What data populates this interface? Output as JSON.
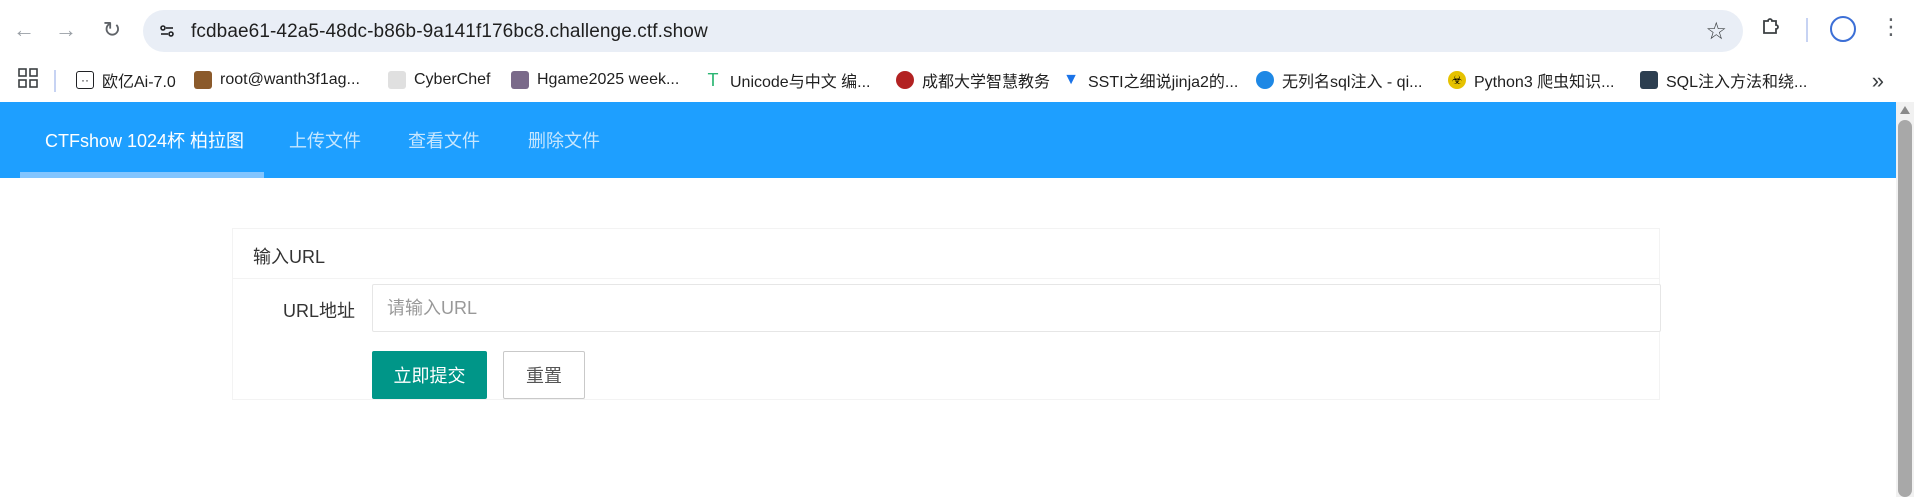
{
  "browser": {
    "url": "fcdbae61-42a5-48dc-b86b-9a141f176bc8.challenge.ctf.show",
    "icons": [
      "back-icon",
      "forward-icon",
      "reload-icon",
      "site-info-icon",
      "star-icon",
      "extensions-icon",
      "profile-icon",
      "menu-icon"
    ]
  },
  "bookmarks": [
    {
      "label": "欧亿Ai-7.0",
      "icon": "chat-icon",
      "color": "#202124"
    },
    {
      "label": "root@wanth3f1ag...",
      "icon": "avatar-icon",
      "color": "#8b5a2b"
    },
    {
      "label": "CyberChef",
      "icon": "chef-icon",
      "color": "#bdbdbd"
    },
    {
      "label": "Hgame2025 week...",
      "icon": "avatar-icon",
      "color": "#7a6a8a"
    },
    {
      "label": "Unicode与中文 编...",
      "icon": "t-icon",
      "color": "#2bb673"
    },
    {
      "label": "成都大学智慧教务",
      "icon": "seal-icon",
      "color": "#b22222"
    },
    {
      "label": "SSTI之细说jinja2的...",
      "icon": "shield-icon",
      "color": "#1a73e8"
    },
    {
      "label": "无列名sql注入 - qi...",
      "icon": "circle-icon",
      "color": "#1e88e5"
    },
    {
      "label": "Python3 爬虫知识...",
      "icon": "biohazard-icon",
      "color": "#e6c200"
    },
    {
      "label": "SQL注入方法和绕...",
      "icon": "image-icon",
      "color": "#2c3e50"
    }
  ],
  "nav": {
    "items": [
      "CTFshow 1024杯 柏拉图",
      "上传文件",
      "查看文件",
      "删除文件"
    ],
    "active_index": 0
  },
  "form": {
    "header": "输入URL",
    "url_label": "URL地址",
    "url_placeholder": "请输入URL",
    "url_value": "",
    "submit_label": "立即提交",
    "reset_label": "重置"
  },
  "colors": {
    "nav_bg": "#1e9fff",
    "submit_bg": "#009688",
    "omnibox_bg": "#e9eef6"
  }
}
